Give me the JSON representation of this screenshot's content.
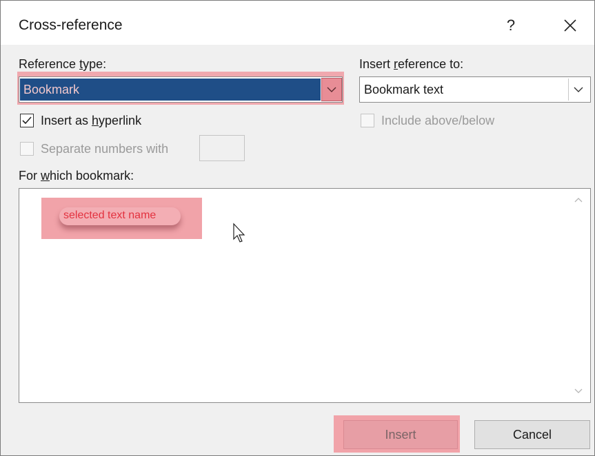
{
  "dialog": {
    "title": "Cross-reference",
    "help_label": "?",
    "close_label": "✕"
  },
  "reference_type": {
    "label_before": "Reference ",
    "label_u": "t",
    "label_after": "ype:",
    "value": "Bookmark"
  },
  "insert_reference_to": {
    "label_before": "Insert ",
    "label_u": "r",
    "label_after": "eference to:",
    "value": "Bookmark text"
  },
  "insert_as_hyperlink": {
    "label_before": "Insert as ",
    "label_u": "h",
    "label_after": "yperlink",
    "checked": true
  },
  "include_above_below": {
    "label": "Include above/below",
    "checked": false,
    "enabled": false
  },
  "separate_numbers": {
    "label": "Separate numbers with",
    "value": "",
    "enabled": false
  },
  "for_which": {
    "label_before": "For ",
    "label_u": "w",
    "label_after": "hich bookmark:",
    "annotation": "selected text name"
  },
  "buttons": {
    "insert": "Insert",
    "cancel": "Cancel"
  },
  "colors": {
    "highlight": "#f1a3a9",
    "selection": "#1f4e87",
    "annotation_text": "#e3323f"
  }
}
